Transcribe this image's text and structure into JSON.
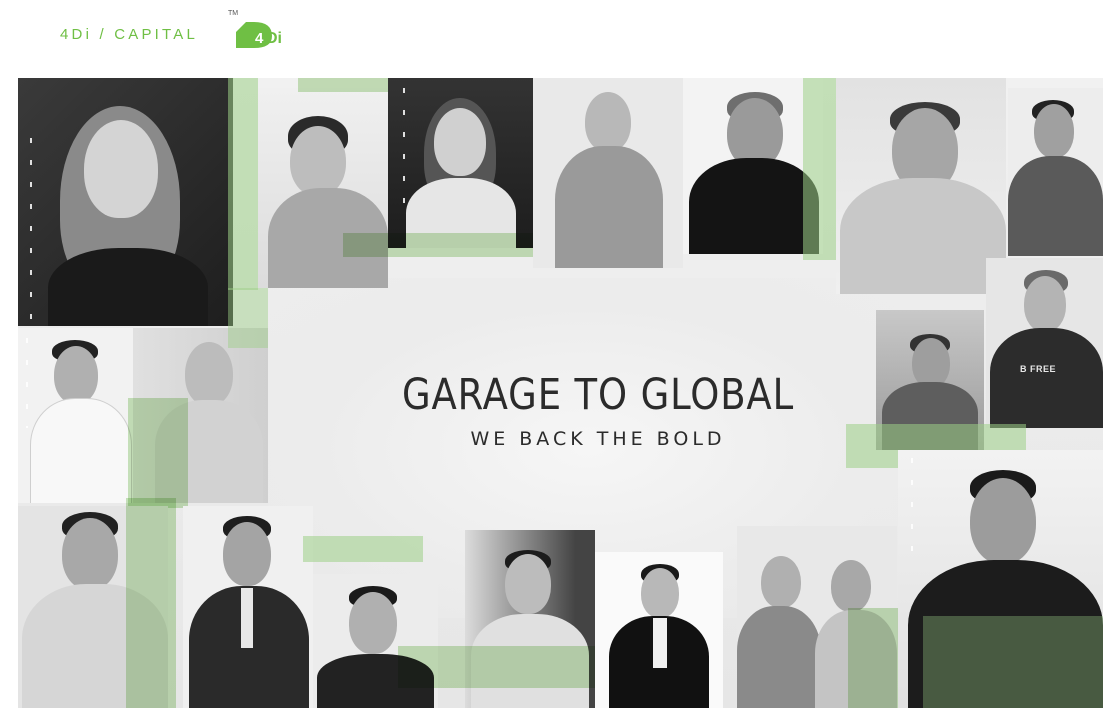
{
  "header": {
    "brand_text": "4Di / CAPITAL",
    "logo_mark": "4Di",
    "trademark": "TM"
  },
  "hero": {
    "headline": "GARAGE TO GLOBAL",
    "subheadline": "WE BACK THE BOLD"
  },
  "colors": {
    "brand_green": "#6fbf44",
    "overlay_green": "#9ccf86",
    "headline_text": "#2b2b2b"
  },
  "portraits": {
    "tshirt_text": "B FREE"
  }
}
